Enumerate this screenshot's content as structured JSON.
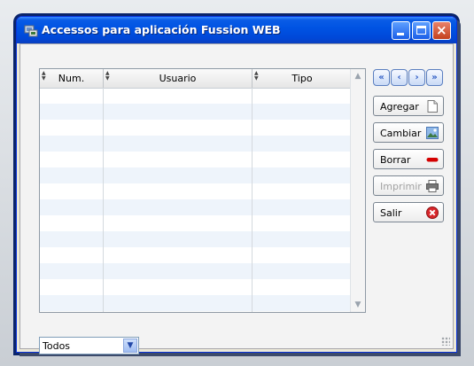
{
  "window": {
    "title": "Accessos para aplicación Fussion WEB",
    "controls": [
      "minimize",
      "maximize",
      "close"
    ]
  },
  "table": {
    "columns": [
      "Num.",
      "Usuario",
      "Tipo"
    ],
    "rows": []
  },
  "nav": {
    "first": "«",
    "prev": "‹",
    "next": "›",
    "last": "»"
  },
  "buttons": {
    "agregar": "Agregar",
    "cambiar": "Cambiar",
    "borrar": "Borrar",
    "imprimir": "Imprimir",
    "salir": "Salir"
  },
  "filter": {
    "selected": "Todos"
  },
  "colors": {
    "titlebar": "#0054e3",
    "accent": "#2b59c3",
    "row_alt": "#eef4fb",
    "borrar_icon": "#d40000",
    "salir_icon": "#d8262a"
  },
  "icons": {
    "agregar": "document-icon",
    "cambiar": "picture-icon",
    "borrar": "minus-icon",
    "imprimir": "printer-icon",
    "salir": "close-circle-icon"
  }
}
